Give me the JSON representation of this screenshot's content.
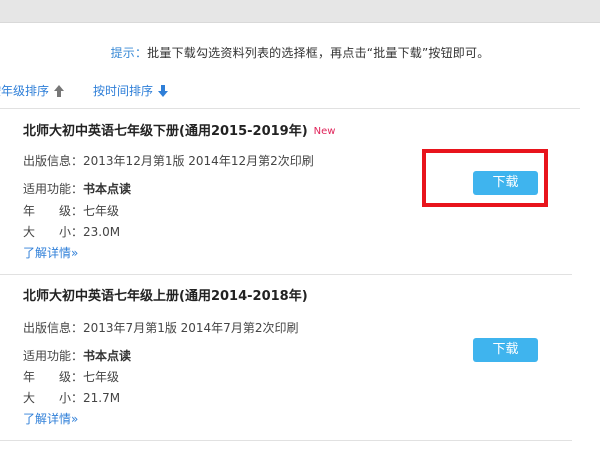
{
  "tip": {
    "label": "提示：",
    "text": "批量下载勾选资料列表的选择框，再点击“批量下载”按钮即可。"
  },
  "sort": {
    "grade_label": "按年级排序",
    "time_label": "按时间排序"
  },
  "items": [
    {
      "title": "北师大初中英语七年级下册(通用2015-2019年)",
      "badge": "New",
      "publish_label": "出版信息：",
      "publish_value": "2013年12月第1版 2014年12月第2次印刷",
      "function_label": "适用功能：",
      "function_value": "书本点读",
      "grade_label": "年　　级：",
      "grade_value": "七年级",
      "size_label": "大　　小：",
      "size_value": "23.0M",
      "detail_label": "了解详情»",
      "download_label": "下载"
    },
    {
      "title": "北师大初中英语七年级上册(通用2014-2018年)",
      "publish_label": "出版信息：",
      "publish_value": "2013年7月第1版 2014年7月第2次印刷",
      "function_label": "适用功能：",
      "function_value": "书本点读",
      "grade_label": "年　　级：",
      "grade_value": "七年级",
      "size_label": "大　　小：",
      "size_value": "21.7M",
      "detail_label": "了解详情»",
      "download_label": "下载"
    }
  ],
  "colors": {
    "link": "#2f7fd8",
    "download_button": "#3fb4ee",
    "new_badge": "#e0245a",
    "highlight": "#e8141c"
  },
  "icons": {
    "grade_sort": "arrow-up-icon",
    "time_sort": "arrow-down-icon"
  }
}
